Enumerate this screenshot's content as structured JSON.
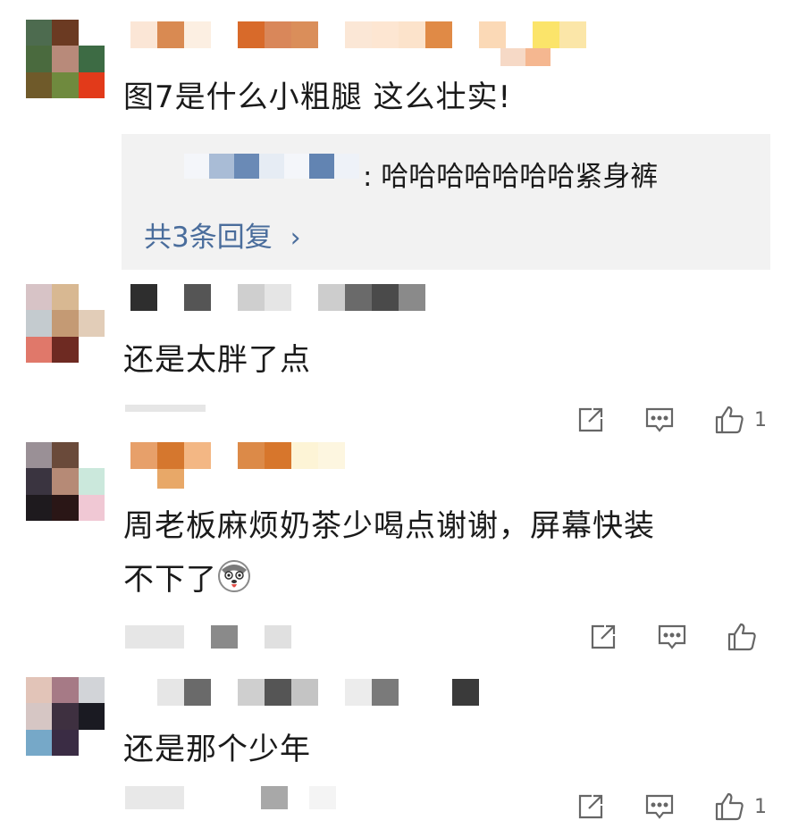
{
  "comments": [
    {
      "text": "图7是什么小粗腿 这么壮实!",
      "replies": {
        "preview_text": ": 哈哈哈哈哈哈哈紧身裤",
        "more_label": "共3条回复",
        "more_chevron": "›"
      }
    },
    {
      "text": "还是太胖了点",
      "like_count": "1",
      "icons": [
        "share-icon",
        "comment-icon",
        "like-icon"
      ]
    },
    {
      "text_line1": "周老板麻烦奶茶少喝点谢谢，屏幕快装",
      "text_line2": "不下了",
      "emoji": "husky-emoji-icon",
      "like_count": "",
      "icons": [
        "share-icon",
        "comment-icon",
        "like-icon"
      ]
    },
    {
      "text": "还是那个少年",
      "like_count": "1",
      "icons": [
        "share-icon",
        "comment-icon",
        "like-icon"
      ]
    }
  ],
  "colors": {
    "link_blue": "#4a6d9c",
    "reply_bg": "#f2f2f2",
    "icon_gray": "#666666"
  }
}
